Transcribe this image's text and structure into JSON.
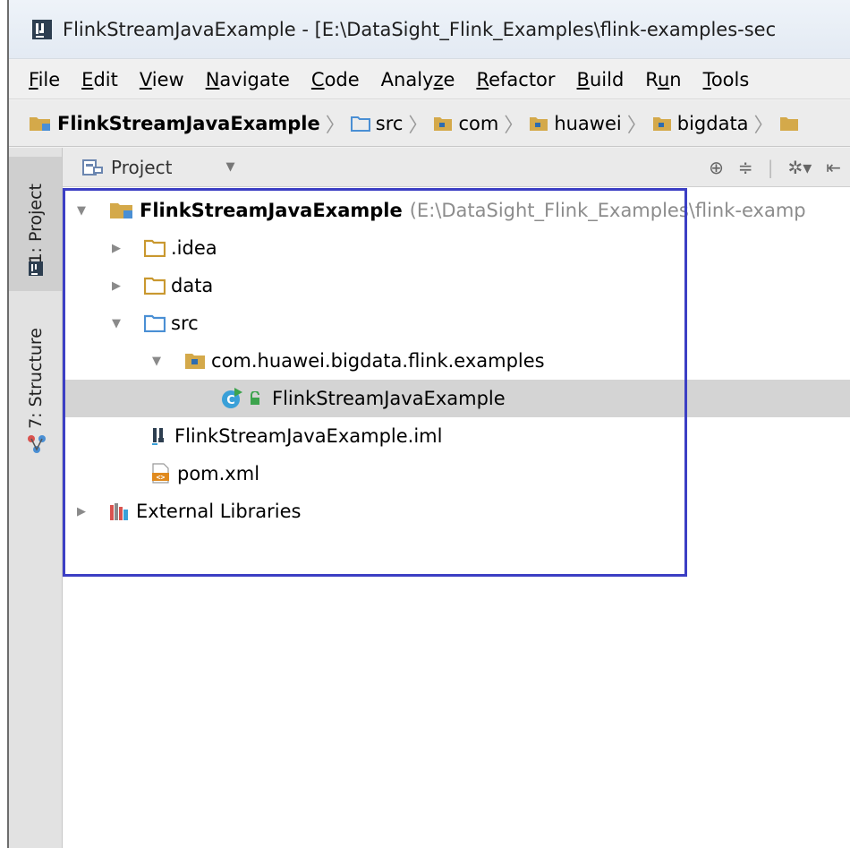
{
  "window": {
    "title": "FlinkStreamJavaExample - [E:\\DataSight_Flink_Examples\\flink-examples-sec"
  },
  "menu": [
    {
      "pre": "",
      "u": "F",
      "post": "ile"
    },
    {
      "pre": "",
      "u": "E",
      "post": "dit"
    },
    {
      "pre": "",
      "u": "V",
      "post": "iew"
    },
    {
      "pre": "",
      "u": "N",
      "post": "avigate"
    },
    {
      "pre": "",
      "u": "C",
      "post": "ode"
    },
    {
      "pre": "Analy",
      "u": "z",
      "post": "e"
    },
    {
      "pre": "",
      "u": "R",
      "post": "efactor"
    },
    {
      "pre": "",
      "u": "B",
      "post": "uild"
    },
    {
      "pre": "R",
      "u": "u",
      "post": "n"
    },
    {
      "pre": "",
      "u": "T",
      "post": "ools"
    }
  ],
  "breadcrumb": [
    "FlinkStreamJavaExample",
    "src",
    "com",
    "huawei",
    "bigdata"
  ],
  "tool_strip": {
    "project_tab": "1: Project",
    "structure_tab": "7: Structure"
  },
  "panel": {
    "selector_label": "Project"
  },
  "tree": {
    "root_label": "FlinkStreamJavaExample",
    "root_path": "(E:\\DataSight_Flink_Examples\\flink-examp",
    "idea": ".idea",
    "data": "data",
    "src": "src",
    "package": "com.huawei.bigdata.flink.examples",
    "class": "FlinkStreamJavaExample",
    "iml": "FlinkStreamJavaExample.iml",
    "pom": "pom.xml",
    "ext_libs": "External Libraries"
  },
  "colors": {
    "highlight": "#3c3fc4",
    "folder": "#d4a94a",
    "source_folder": "#4a8fd4",
    "selection": "#d4d4d4"
  }
}
